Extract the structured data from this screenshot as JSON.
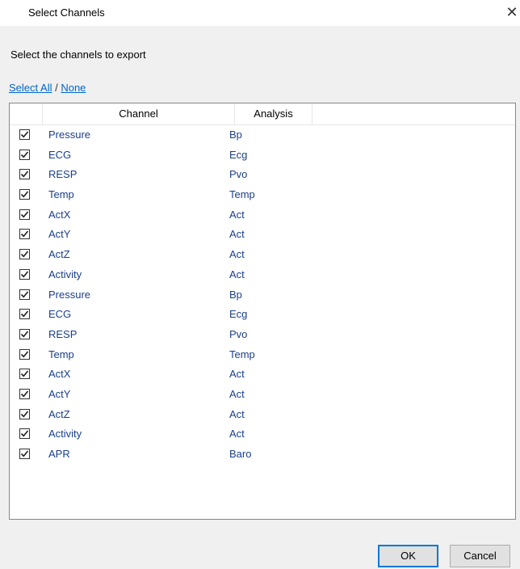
{
  "window": {
    "title": "Select Channels",
    "close_glyph": "✕"
  },
  "instruction": "Select the channels to export",
  "select_links": {
    "all": "Select All",
    "separator": " / ",
    "none": "None"
  },
  "grid": {
    "headers": {
      "check": "",
      "channel": "Channel",
      "analysis": "Analysis"
    },
    "rows": [
      {
        "checked": true,
        "channel": "Pressure",
        "analysis": "Bp"
      },
      {
        "checked": true,
        "channel": "ECG",
        "analysis": "Ecg"
      },
      {
        "checked": true,
        "channel": "RESP",
        "analysis": "Pvo"
      },
      {
        "checked": true,
        "channel": "Temp",
        "analysis": "Temp"
      },
      {
        "checked": true,
        "channel": "ActX",
        "analysis": "Act"
      },
      {
        "checked": true,
        "channel": "ActY",
        "analysis": "Act"
      },
      {
        "checked": true,
        "channel": "ActZ",
        "analysis": "Act"
      },
      {
        "checked": true,
        "channel": "Activity",
        "analysis": "Act"
      },
      {
        "checked": true,
        "channel": "Pressure",
        "analysis": "Bp"
      },
      {
        "checked": true,
        "channel": "ECG",
        "analysis": "Ecg"
      },
      {
        "checked": true,
        "channel": "RESP",
        "analysis": "Pvo"
      },
      {
        "checked": true,
        "channel": "Temp",
        "analysis": "Temp"
      },
      {
        "checked": true,
        "channel": "ActX",
        "analysis": "Act"
      },
      {
        "checked": true,
        "channel": "ActY",
        "analysis": "Act"
      },
      {
        "checked": true,
        "channel": "ActZ",
        "analysis": "Act"
      },
      {
        "checked": true,
        "channel": "Activity",
        "analysis": "Act"
      },
      {
        "checked": true,
        "channel": "APR",
        "analysis": "Baro"
      }
    ]
  },
  "buttons": {
    "ok": "OK",
    "cancel": "Cancel"
  },
  "colors": {
    "link": "#0066cc",
    "cell_text": "#1a3f8c",
    "default_button_border": "#0078d7"
  }
}
